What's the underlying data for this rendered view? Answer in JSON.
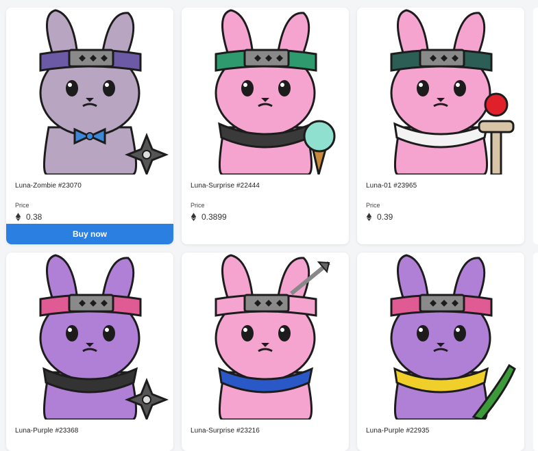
{
  "labels": {
    "price": "Price",
    "buy": "Buy now"
  },
  "cards": [
    {
      "name": "Luna-Zombie #23070",
      "price": "0.38",
      "body": "#b7a5c2",
      "band": "#6c5aa6",
      "scarf": "#3f88d8",
      "bg": "#ffffff",
      "accessory": "bowtie-icon",
      "held": "shuriken-icon"
    },
    {
      "name": "Luna-Surprise #22444",
      "price": "0.3899",
      "body": "#f5a3cf",
      "band": "#2e9a6e",
      "scarf": "#3a3a3a",
      "bg": "#ffffff",
      "accessory": "scarf-icon",
      "held": "ice-cream-icon"
    },
    {
      "name": "Luna-01 #23965",
      "price": "0.39",
      "body": "#f5a3cf",
      "band": "#2c5e56",
      "scarf": "#f3f3f3",
      "bg": "#ffffff",
      "accessory": "bandana-icon",
      "held": "kendama-icon"
    },
    {
      "name": "Luna-Purple #23368",
      "price": "",
      "body": "#b07fd6",
      "band": "#e05a93",
      "scarf": "#333333",
      "bg": "#ffffff",
      "accessory": "bandana-icon",
      "held": "shuriken-icon"
    },
    {
      "name": "Luna-Surprise #23216",
      "price": "",
      "body": "#f5a3cf",
      "band": "#f5a3cf",
      "scarf": "#2a58c7",
      "bg": "#ffffff",
      "accessory": "scarf-icon",
      "held": "arrow-icon"
    },
    {
      "name": "Luna-Purple #22935",
      "price": "",
      "body": "#b07fd6",
      "band": "#e05a93",
      "scarf": "#f1cf2a",
      "bg": "#ffffff",
      "accessory": "scarf-icon",
      "held": "cucumber-icon"
    }
  ]
}
